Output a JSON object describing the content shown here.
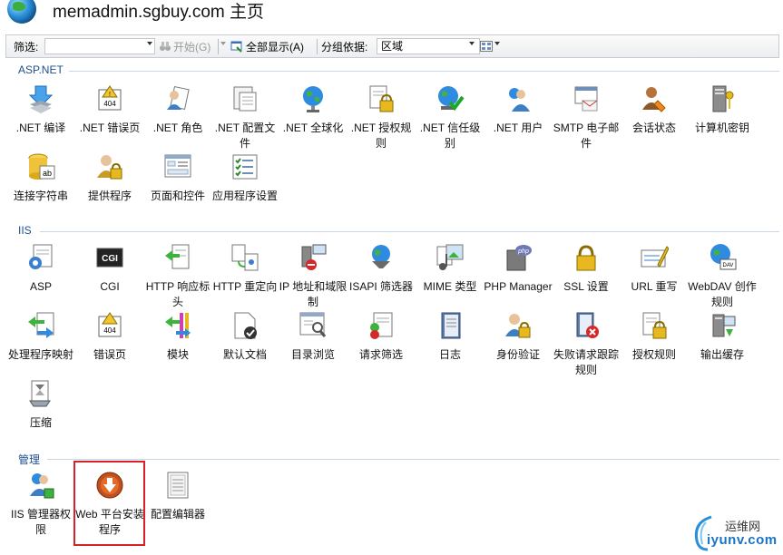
{
  "header": {
    "title": "memadmin.sgbuy.com 主页"
  },
  "toolbar": {
    "filter_label": "筛选:",
    "filter_value": "",
    "start_label": "开始(G)",
    "show_all_label": "全部显示(A)",
    "group_by_label": "分组依据:",
    "group_by_value": "区域"
  },
  "sections": {
    "aspnet": {
      "label": "ASP.NET",
      "items": [
        {
          "label": ".NET 编译",
          "icon": "compile-icon"
        },
        {
          "label": ".NET 错误页",
          "icon": "error-page-icon"
        },
        {
          "label": ".NET 角色",
          "icon": "roles-icon"
        },
        {
          "label": ".NET 配置文件",
          "icon": "profile-icon"
        },
        {
          "label": ".NET 全球化",
          "icon": "globe-icon"
        },
        {
          "label": ".NET 授权规则",
          "icon": "authorization-icon"
        },
        {
          "label": ".NET 信任级别",
          "icon": "trust-level-icon"
        },
        {
          "label": ".NET 用户",
          "icon": "users-icon"
        },
        {
          "label": "SMTP 电子邮件",
          "icon": "smtp-icon"
        },
        {
          "label": "会话状态",
          "icon": "session-state-icon"
        },
        {
          "label": "计算机密钥",
          "icon": "machine-key-icon"
        },
        {
          "label": "连接字符串",
          "icon": "connection-string-icon"
        },
        {
          "label": "提供程序",
          "icon": "providers-icon"
        },
        {
          "label": "页面和控件",
          "icon": "pages-controls-icon"
        },
        {
          "label": "应用程序设置",
          "icon": "app-settings-icon"
        }
      ]
    },
    "iis": {
      "label": "IIS",
      "items": [
        {
          "label": "ASP",
          "icon": "asp-icon"
        },
        {
          "label": "CGI",
          "icon": "cgi-icon"
        },
        {
          "label": "HTTP 响应标头",
          "icon": "http-headers-icon"
        },
        {
          "label": "HTTP 重定向",
          "icon": "http-redirect-icon"
        },
        {
          "label": "IP 地址和域限制",
          "icon": "ip-restrictions-icon"
        },
        {
          "label": "ISAPI 筛选器",
          "icon": "isapi-filter-icon"
        },
        {
          "label": "MIME 类型",
          "icon": "mime-types-icon"
        },
        {
          "label": "PHP Manager",
          "icon": "php-manager-icon"
        },
        {
          "label": "SSL 设置",
          "icon": "ssl-lock-icon"
        },
        {
          "label": "URL 重写",
          "icon": "url-rewrite-icon"
        },
        {
          "label": "WebDAV 创作规则",
          "icon": "webdav-icon"
        },
        {
          "label": "处理程序映射",
          "icon": "handler-mappings-icon"
        },
        {
          "label": "错误页",
          "icon": "error-page-icon"
        },
        {
          "label": "模块",
          "icon": "modules-icon"
        },
        {
          "label": "默认文档",
          "icon": "default-document-icon"
        },
        {
          "label": "目录浏览",
          "icon": "directory-browsing-icon"
        },
        {
          "label": "请求筛选",
          "icon": "request-filtering-icon"
        },
        {
          "label": "日志",
          "icon": "logging-icon"
        },
        {
          "label": "身份验证",
          "icon": "authentication-icon"
        },
        {
          "label": "失败请求跟踪规则",
          "icon": "failed-request-icon"
        },
        {
          "label": "授权规则",
          "icon": "authorization-icon"
        },
        {
          "label": "输出缓存",
          "icon": "output-cache-icon"
        },
        {
          "label": "压缩",
          "icon": "compression-icon"
        }
      ]
    },
    "management": {
      "label": "管理",
      "items": [
        {
          "label": "IIS 管理器权限",
          "icon": "manager-permissions-icon"
        },
        {
          "label": "Web 平台安装程序",
          "icon": "web-platform-installer-icon"
        },
        {
          "label": "配置编辑器",
          "icon": "configuration-editor-icon"
        }
      ]
    }
  },
  "watermark": {
    "line1": "运维网",
    "line2": "iyunv.com"
  },
  "colors": {
    "section_label": "#1d4f91",
    "highlight": "#d6202a",
    "toolbar_border": "#c8ccd2"
  }
}
